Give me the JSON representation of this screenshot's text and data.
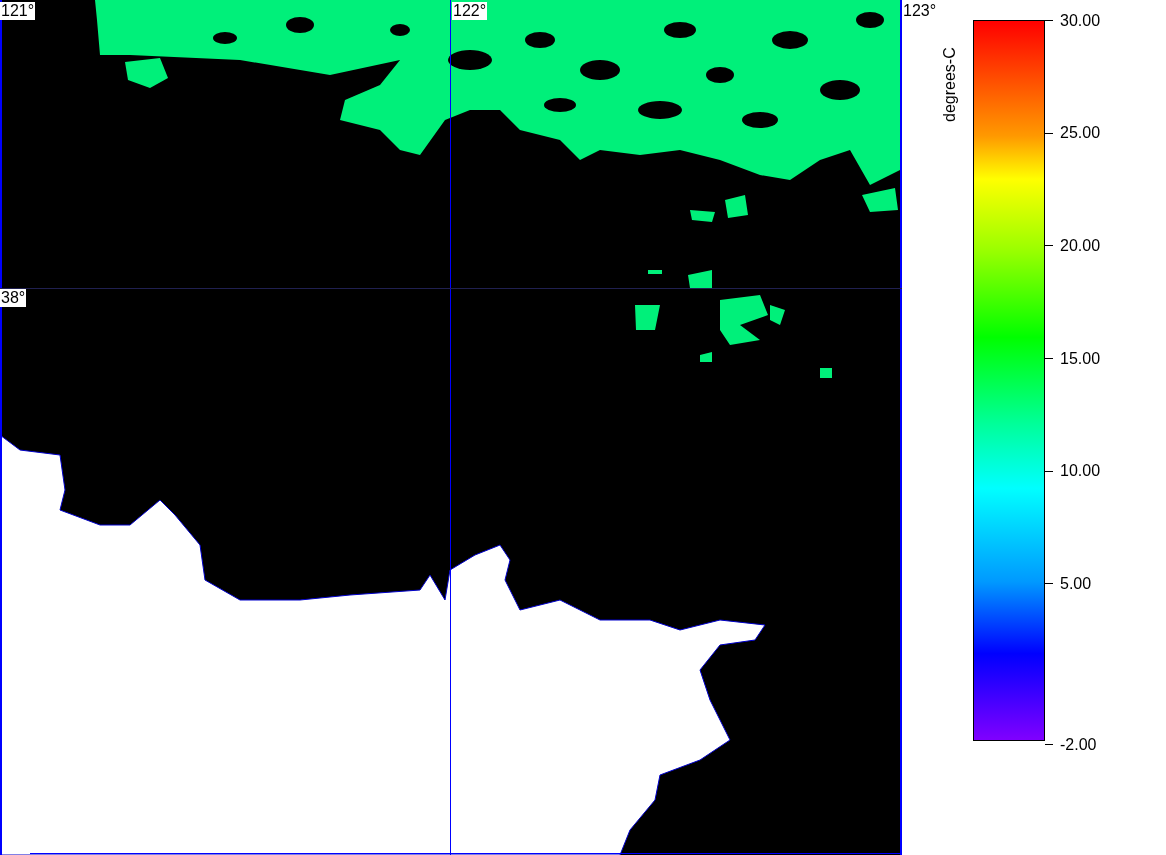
{
  "map": {
    "longitude_labels": [
      "121°",
      "122°",
      "123°"
    ],
    "latitude_labels": [
      "38°"
    ]
  },
  "colorbar": {
    "unit": "degrees-C",
    "tick_labels": [
      "30.00",
      "25.00",
      "20.00",
      "15.00",
      "10.00",
      "5.00",
      "-2.00"
    ]
  }
}
